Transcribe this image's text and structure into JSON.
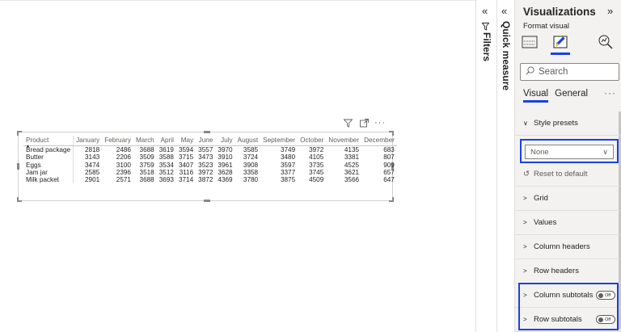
{
  "table": {
    "headers": [
      "Product",
      "January",
      "February",
      "March",
      "April",
      "May",
      "June",
      "July",
      "August",
      "September",
      "October",
      "November",
      "December"
    ],
    "rows": [
      [
        "Bread package",
        "2818",
        "2486",
        "3688",
        "3619",
        "3594",
        "3557",
        "3970",
        "3585",
        "3749",
        "3972",
        "4135",
        "683"
      ],
      [
        "Butter",
        "3143",
        "2206",
        "3509",
        "3588",
        "3715",
        "3473",
        "3910",
        "3724",
        "3480",
        "4105",
        "3381",
        "807"
      ],
      [
        "Eggs",
        "3474",
        "3100",
        "3759",
        "3534",
        "3407",
        "3523",
        "3961",
        "3908",
        "3597",
        "3735",
        "4525",
        "909"
      ],
      [
        "Jam jar",
        "2585",
        "2396",
        "3518",
        "3512",
        "3116",
        "3972",
        "3628",
        "3358",
        "3377",
        "3745",
        "3621",
        "657"
      ],
      [
        "Milk packet",
        "2901",
        "2571",
        "3688",
        "3693",
        "3714",
        "3872",
        "4369",
        "3780",
        "3875",
        "4509",
        "3566",
        "647"
      ]
    ]
  },
  "visual_header_icons": [
    "filter-icon",
    "focus-mode-icon",
    "more-options-icon"
  ],
  "filters": {
    "label": "Filters",
    "chevron": "«"
  },
  "quick_measure": {
    "label": "Quick measure",
    "chevron": "«"
  },
  "viz": {
    "title": "Visualizations",
    "expand": "»",
    "format_visual": "Format visual",
    "search_placeholder": "Search",
    "tabs": [
      "Visual",
      "General"
    ],
    "tab_more": "···",
    "style_presets": "Style presets",
    "preset_value": "None",
    "reset": "Reset to default",
    "sections": [
      "Grid",
      "Values",
      "Column headers",
      "Row headers"
    ],
    "toggle_sections": [
      "Column subtotals",
      "Row subtotals"
    ],
    "toggle_state": "Off",
    "accent": "#1a42e0"
  }
}
